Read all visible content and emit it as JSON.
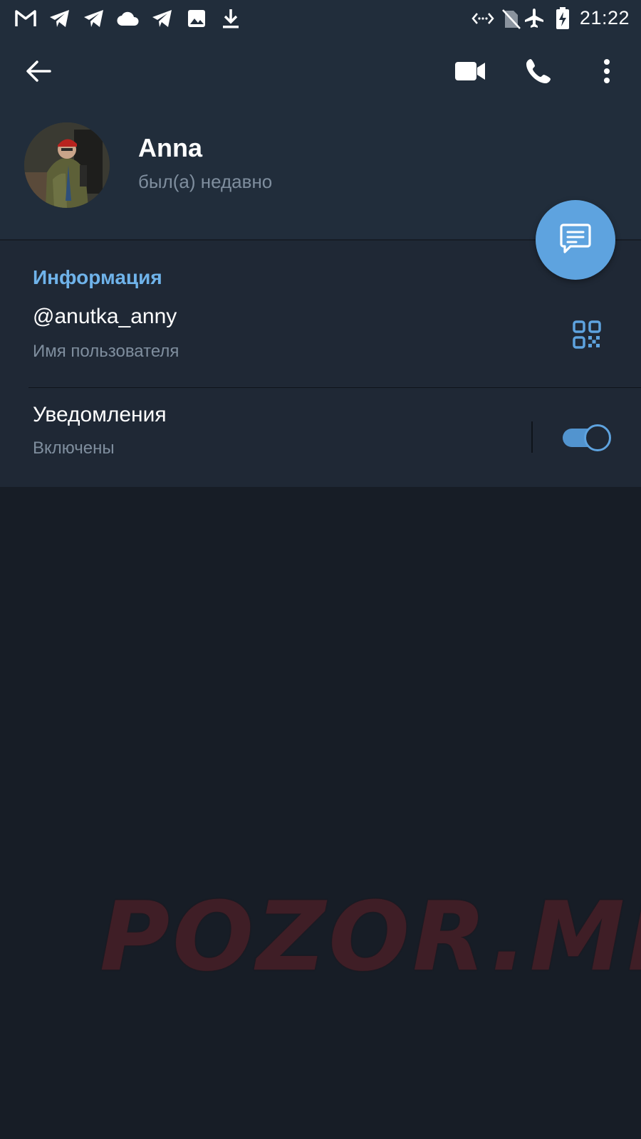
{
  "status_bar": {
    "time": "21:22",
    "left_icons": [
      "gmail-icon",
      "telegram-icon",
      "telegram-icon",
      "cloud-icon",
      "telegram-icon",
      "image-icon",
      "download-icon"
    ],
    "right_icons": [
      "data-saver-icon",
      "no-sim-icon",
      "airplane-icon",
      "battery-charging-icon"
    ]
  },
  "toolbar": {
    "icons": [
      "back-arrow-icon",
      "video-call-icon",
      "phone-icon",
      "more-vert-icon"
    ]
  },
  "profile": {
    "name": "Anna",
    "status": "был(а) недавно"
  },
  "fab": {
    "icon": "message-icon"
  },
  "info": {
    "section_title": "Информация",
    "username": {
      "value": "@anutka_anny",
      "label": "Имя пользователя",
      "icon": "qr-code-icon"
    },
    "notifications": {
      "value": "Уведомления",
      "label": "Включены",
      "enabled": true
    }
  },
  "watermark": "POZOR.ME",
  "colors": {
    "background": "#171d26",
    "header": "#212d3b",
    "section": "#1f2835",
    "accent": "#5ea3df",
    "section_title": "#6fb3ea",
    "secondary_text": "#7f8e9e",
    "watermark": "#4a1f27"
  }
}
